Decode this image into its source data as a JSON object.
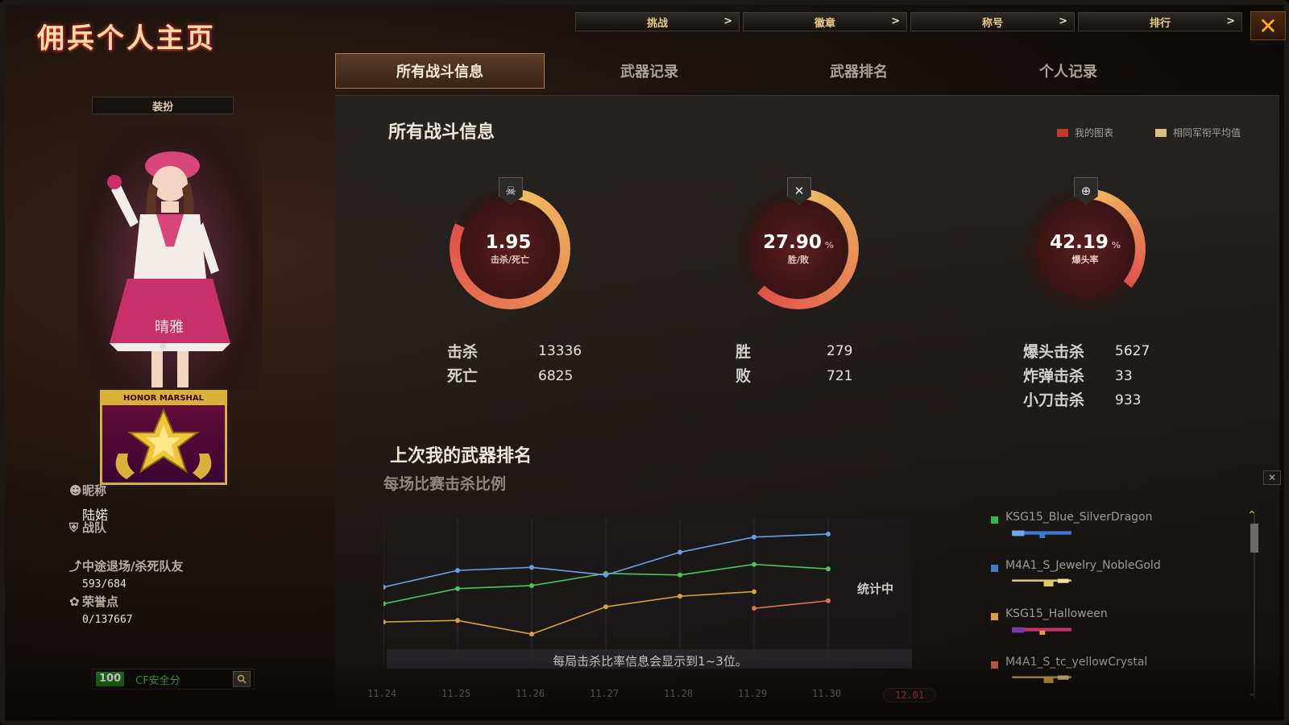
{
  "app_title": "佣兵个人主页",
  "top_nav": [
    {
      "label": "挑战",
      "chevron": ">"
    },
    {
      "label": "徽章",
      "chevron": ">"
    },
    {
      "label": "称号",
      "chevron": ">"
    },
    {
      "label": "排行",
      "chevron": ">"
    }
  ],
  "close_glyph": "✕",
  "tabs": [
    {
      "label": "所有战斗信息",
      "active": true
    },
    {
      "label": "武器记录",
      "active": false
    },
    {
      "label": "武器排名",
      "active": false
    },
    {
      "label": "个人记录",
      "active": false
    }
  ],
  "left": {
    "outfit_button": "装扮",
    "character_name": "晴雅",
    "badge_text": "HONOR MARSHAL",
    "nickname_label": "昵称",
    "nickname_value": "陆婼",
    "team_label": "战队",
    "quit_label": "中途退场/杀死队友",
    "quit_value": "593/684",
    "honor_label": "荣誉点",
    "honor_value": "0/137667",
    "safety_score": "100",
    "safety_label": "CF安全分"
  },
  "main": {
    "section_title": "所有战斗信息",
    "legend": [
      {
        "label": "我的图表",
        "color": "#c0392b"
      },
      {
        "label": "相同军衔平均值",
        "color": "#d9c27a"
      }
    ],
    "rings": [
      {
        "value": "1.95",
        "unit": "",
        "label": "击杀/死亡",
        "icon": "skull-icon",
        "icon_glyph": "☠",
        "progress": 0.82
      },
      {
        "value": "27.90",
        "unit": "%",
        "label": "胜/败",
        "icon": "crossed-guns-icon",
        "icon_glyph": "✕",
        "progress": 0.62
      },
      {
        "value": "42.19",
        "unit": "%",
        "label": "爆头率",
        "icon": "crosshair-icon",
        "icon_glyph": "⊕",
        "progress": 0.36
      }
    ],
    "stats": {
      "kills_label": "击杀",
      "kills_value": "13336",
      "deaths_label": "死亡",
      "deaths_value": "6825",
      "wins_label": "胜",
      "wins_value": "279",
      "losses_label": "败",
      "losses_value": "721",
      "headshot_label": "爆头击杀",
      "headshot_value": "5627",
      "bomb_label": "炸弹击杀",
      "bomb_value": "33",
      "knife_label": "小刀击杀",
      "knife_value": "933"
    },
    "weapon_rank_title": "上次我的武器排名",
    "weapon_rank_subtitle": "每场比赛击杀比例",
    "chart_note": "每局击杀比率信息会显示到1~3位。",
    "chart_status": "统计中",
    "weapons": [
      {
        "name": "KSG15_Blue_SilverDragon",
        "color": "#2fb84a"
      },
      {
        "name": "M4A1_S_Jewelry_NobleGold",
        "color": "#4a78c8"
      },
      {
        "name": "KSG15_Halloween",
        "color": "#d7a23a"
      },
      {
        "name": "M4A1_S_tc_yellowCrystal",
        "color": "#d05a50"
      }
    ]
  },
  "chart_data": {
    "type": "line",
    "categories": [
      "11.24",
      "11.25",
      "11.26",
      "11.27",
      "11.28",
      "11.29",
      "11.30",
      "12.01"
    ],
    "highlight_category": "12.01",
    "series": [
      {
        "name": "KSG15_Blue_SilverDragon",
        "color": "#4fc260",
        "values": [
          0.55,
          0.65,
          0.67,
          0.75,
          0.74,
          0.81,
          0.78,
          null
        ]
      },
      {
        "name": "M4A1_S_Jewelry_NobleGold",
        "color": "#6f9fe0",
        "values": [
          0.66,
          0.77,
          0.79,
          0.74,
          0.89,
          0.99,
          1.01,
          null
        ]
      },
      {
        "name": "KSG15_Halloween",
        "color": "#d7a23a",
        "values": [
          0.43,
          0.44,
          0.35,
          0.53,
          0.6,
          0.63,
          null,
          null
        ]
      },
      {
        "name": "M4A1_S_tc_yellowCrystal",
        "color": "#e0705a",
        "values": [
          null,
          null,
          null,
          null,
          null,
          0.52,
          0.57,
          null
        ]
      }
    ]
  }
}
